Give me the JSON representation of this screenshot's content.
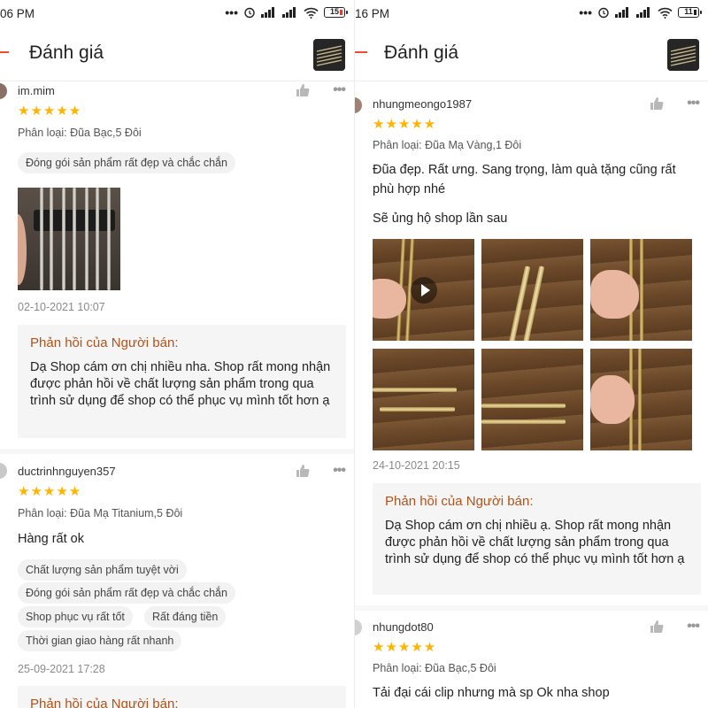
{
  "left": {
    "status": {
      "time": "06 PM",
      "battery": "15"
    },
    "header": {
      "title": "Đánh giá"
    },
    "reviews": [
      {
        "username": "im.mim",
        "stars": "★★★★★",
        "variant": "Phân loại: Đũa Bạc,5 Đôi",
        "tags": [
          "Đóng gói sản phẩm rất đẹp và chắc chắn"
        ],
        "date": "02-10-2021 10:07",
        "reply_title": "Phản hồi của Người bán:",
        "reply_text": "Dạ Shop cám ơn chị nhiều nha. Shop rất mong nhận được phản hồi về chất lượng sản phẩm trong qua trình sử dụng để shop có thể phục vụ mình tốt hơn ạ"
      },
      {
        "username": "ductrinhnguyen357",
        "stars": "★★★★★",
        "variant": "Phân loại: Đũa Mạ Titanium,5 Đôi",
        "comment": "Hàng rất ok",
        "tags": [
          "Chất lượng sản phẩm tuyệt vời",
          "Đóng gói sản phẩm rất đẹp và chắc chắn",
          "Shop phục vụ rất tốt",
          "Rất đáng tiền",
          "Thời gian giao hàng rất nhanh"
        ],
        "date": "25-09-2021 17:28",
        "reply_title": "Phản hồi của Người bán:"
      }
    ]
  },
  "right": {
    "status": {
      "time": "16 PM",
      "battery": "11"
    },
    "header": {
      "title": "Đánh giá"
    },
    "reviews": [
      {
        "username": "nhungmeongo1987",
        "stars": "★★★★★",
        "variant": "Phân loại: Đũa Mạ Vàng,1 Đôi",
        "comment_1": "Đũa đẹp. Rất ưng. Sang trọng, làm quà tặng cũng rất phù hợp nhé",
        "comment_2": "Sẽ ủng hộ shop lần sau",
        "date": "24-10-2021 20:15",
        "reply_title": "Phản hồi của Người bán:",
        "reply_text": "Dạ Shop cám ơn chị nhiều ạ. Shop rất mong nhận được phản hồi về chất lượng sản phẩm trong qua trình sử dụng để shop có thể phục vụ mình tốt hơn ạ"
      },
      {
        "username": "nhungdot80",
        "stars": "★★★★★",
        "variant": "Phân loại: Đũa Bạc,5 Đôi",
        "comment": "Tải đại cái clip nhưng mà sp Ok nha shop"
      }
    ]
  },
  "colors": {
    "accent": "#ee4d2d",
    "star": "#ffb400",
    "reply_title": "#b0531a"
  },
  "icons": [
    "back-arrow-icon",
    "thumbs-up-icon",
    "more-options-icon",
    "play-icon"
  ]
}
